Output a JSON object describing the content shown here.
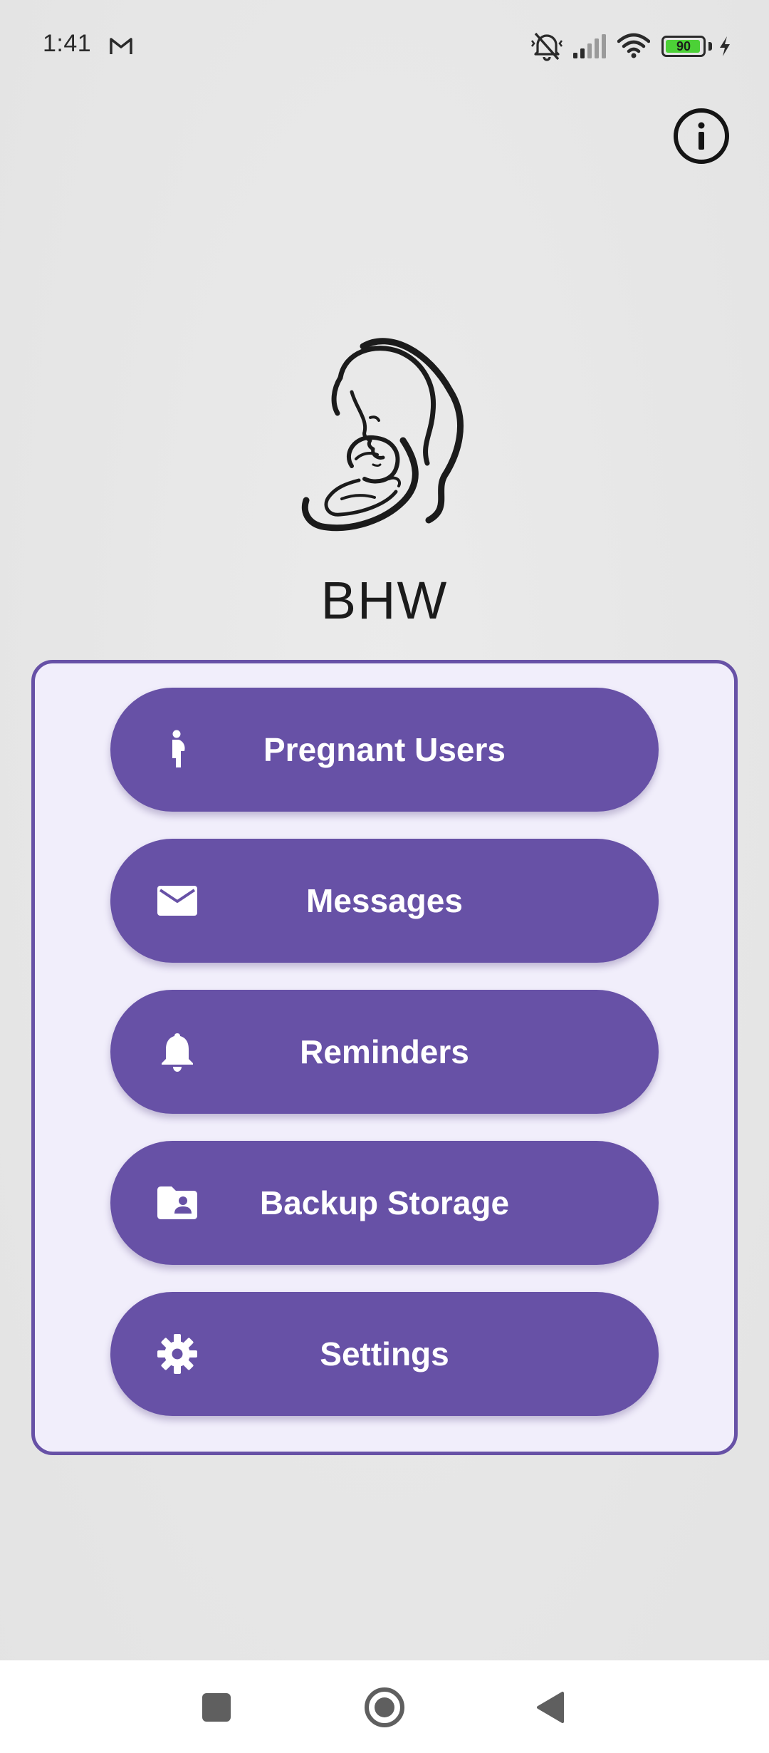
{
  "status_bar": {
    "time": "1:41",
    "battery_level": "90",
    "icons": [
      "gmail-icon",
      "mute-icon",
      "signal-icon",
      "wifi-icon",
      "battery-icon",
      "charging-icon"
    ]
  },
  "header": {
    "info_icon": "info-icon"
  },
  "app": {
    "title": "BHW",
    "logo": "mother-and-baby-logo"
  },
  "menu": {
    "items": [
      {
        "label": "Pregnant Users",
        "icon": "pregnant-woman-icon"
      },
      {
        "label": "Messages",
        "icon": "mail-icon"
      },
      {
        "label": "Reminders",
        "icon": "bell-icon"
      },
      {
        "label": "Backup Storage",
        "icon": "folder-user-icon"
      },
      {
        "label": "Settings",
        "icon": "gear-icon"
      }
    ]
  },
  "navigation": {
    "buttons": [
      "recents-button",
      "home-button",
      "back-button"
    ]
  },
  "colors": {
    "accent": "#6751a6",
    "card_background": "#f1eefb",
    "battery_fill": "#4cd137"
  }
}
